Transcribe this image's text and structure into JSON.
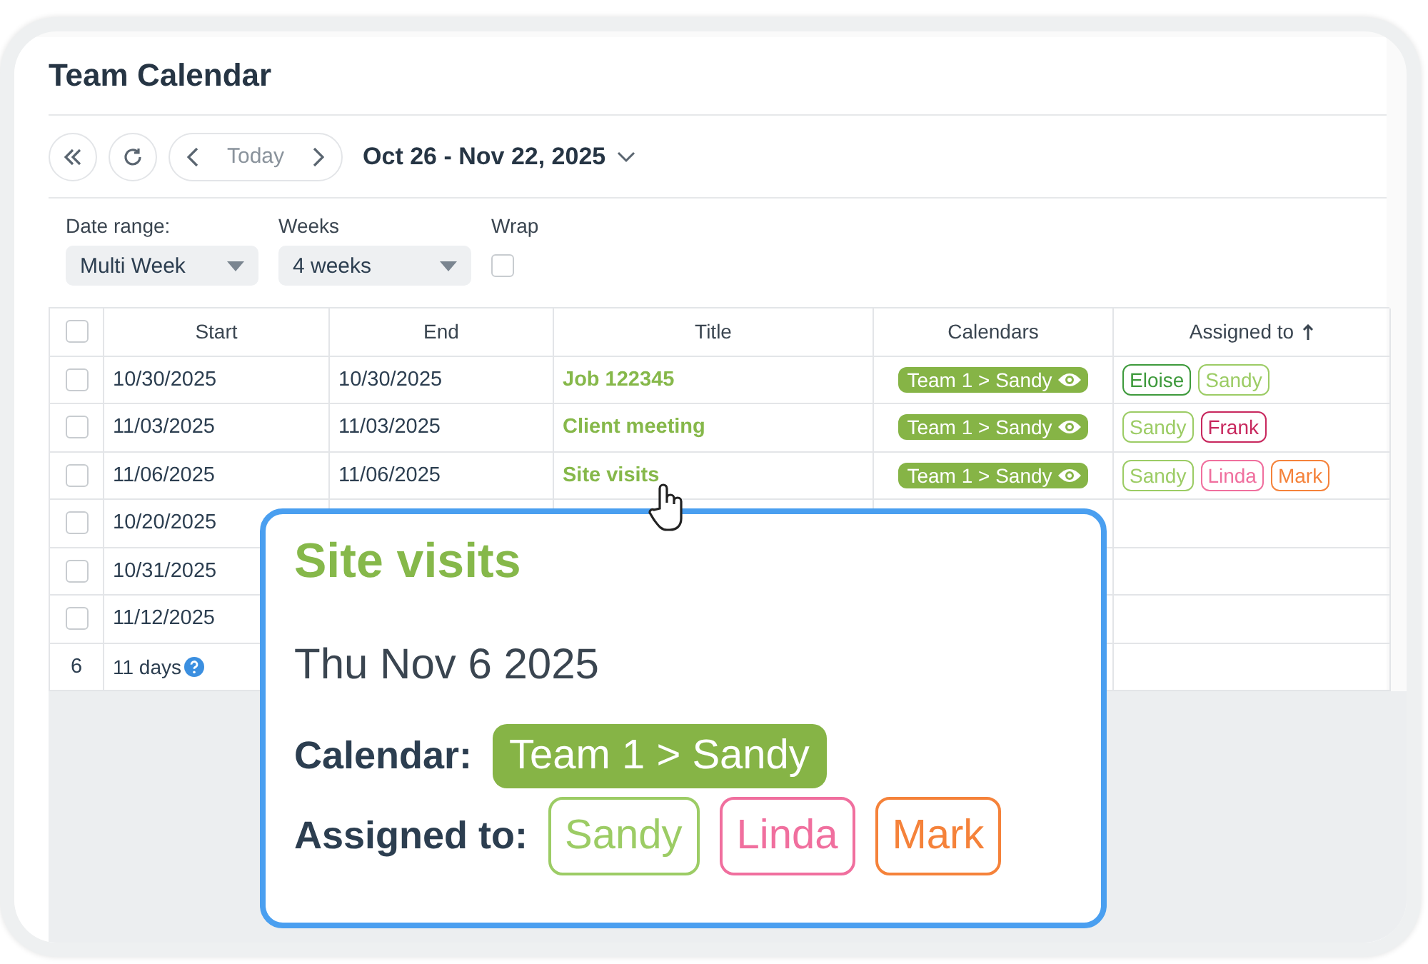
{
  "title": "Team Calendar",
  "toolbar": {
    "today": "Today",
    "range": "Oct 26 - Nov 22, 2025"
  },
  "filters": [
    {
      "kind": "select",
      "label": "Date range:",
      "value": "Multi Week"
    },
    {
      "kind": "select",
      "label": "Weeks",
      "value": "4 weeks"
    },
    {
      "kind": "checkbox",
      "label": "Wrap",
      "checked": false
    }
  ],
  "table": {
    "columns": [
      {
        "label": "Start",
        "sorted": false
      },
      {
        "label": "End",
        "sorted": false
      },
      {
        "label": "Title",
        "sorted": false
      },
      {
        "label": "Calendars",
        "sorted": false
      },
      {
        "label": "Assigned to",
        "sorted": true
      }
    ],
    "all_checked": false,
    "rows": [
      {
        "checked": false,
        "start": "10/30/2025",
        "end": "10/30/2025",
        "title": "Job 122345",
        "calendar": "Team 1 > Sandy",
        "assigned": [
          {
            "name": "Eloise",
            "color": "#3e9a3c"
          },
          {
            "name": "Sandy",
            "color": "#9ccc65"
          }
        ]
      },
      {
        "checked": false,
        "start": "11/03/2025",
        "end": "11/03/2025",
        "title": "Client meeting",
        "calendar": "Team 1 > Sandy",
        "assigned": [
          {
            "name": "Sandy",
            "color": "#9ccc65"
          },
          {
            "name": "Frank",
            "color": "#c8285e"
          }
        ]
      },
      {
        "checked": false,
        "start": "11/06/2025",
        "end": "11/06/2025",
        "title": "Site visits",
        "calendar": "Team 1 > Sandy",
        "assigned": [
          {
            "name": "Sandy",
            "color": "#9ccc65"
          },
          {
            "name": "Linda",
            "color": "#f06f9e"
          },
          {
            "name": "Mark",
            "color": "#f5823a"
          }
        ]
      },
      {
        "checked": false,
        "start": "10/20/2025"
      },
      {
        "checked": false,
        "start": "10/31/2025"
      },
      {
        "checked": false,
        "start": "11/12/2025"
      }
    ],
    "footer": {
      "count": "6",
      "duration": "11 days"
    }
  },
  "popup": {
    "title": "Site visits",
    "date": "Thu Nov 6 2025",
    "calendar_label": "Calendar:",
    "calendar": "Team 1 > Sandy",
    "assigned_label": "Assigned to:",
    "assigned": [
      {
        "name": "Sandy",
        "color": "#9ccc65"
      },
      {
        "name": "Linda",
        "color": "#f06f9e"
      },
      {
        "name": "Mark",
        "color": "#f5823a"
      }
    ]
  }
}
